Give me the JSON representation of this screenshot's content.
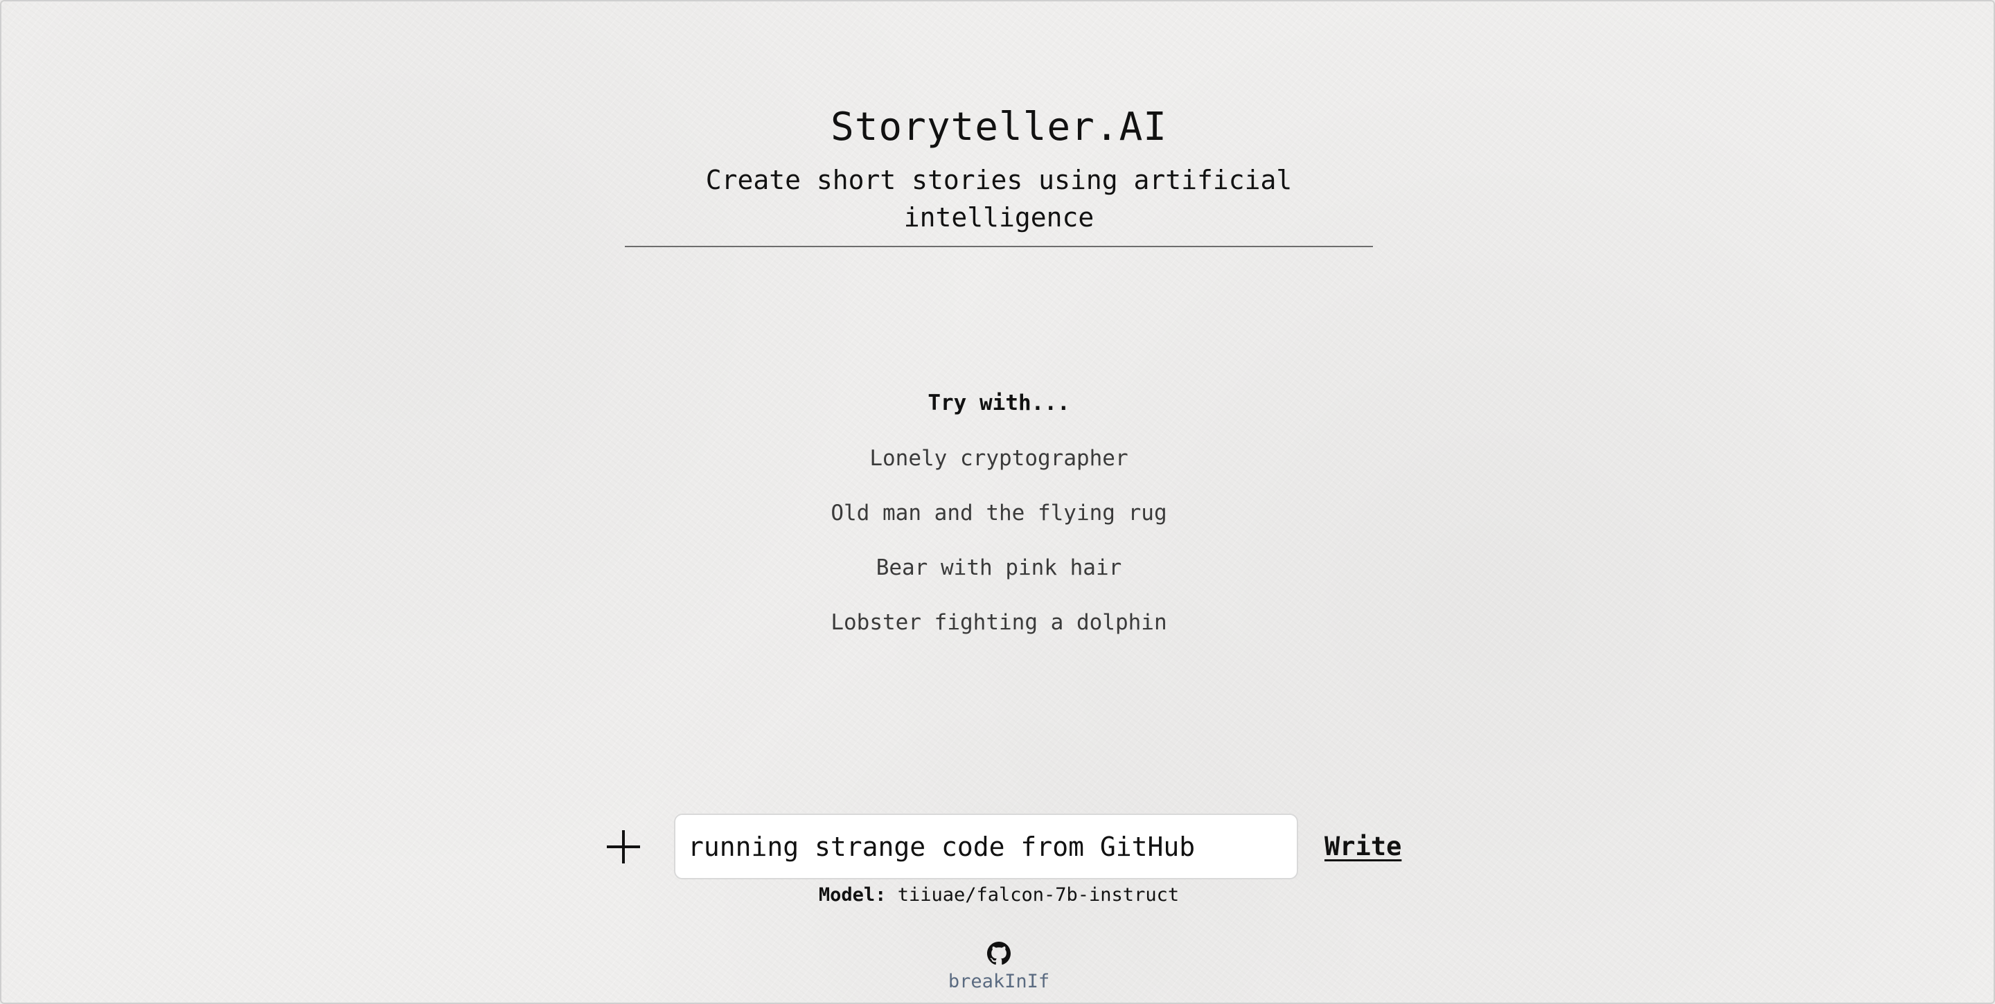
{
  "header": {
    "title": "Storyteller.AI",
    "subtitle": "Create short stories using artificial intelligence"
  },
  "suggestions": {
    "heading": "Try with...",
    "items": [
      "Lonely cryptographer",
      "Old man and the flying rug",
      "Bear with pink hair",
      "Lobster fighting a dolphin"
    ]
  },
  "composer": {
    "plus_icon": "plus-icon",
    "input_value": "running strange code from GitHub",
    "write_label": "Write"
  },
  "model": {
    "label": "Model:",
    "name": "tiiuae/falcon-7b-instruct"
  },
  "footer": {
    "icon": "github-icon",
    "link_text": "breakInIf"
  },
  "colors": {
    "background": "#efeeed",
    "text": "#111111",
    "link": "#5a6a80"
  }
}
